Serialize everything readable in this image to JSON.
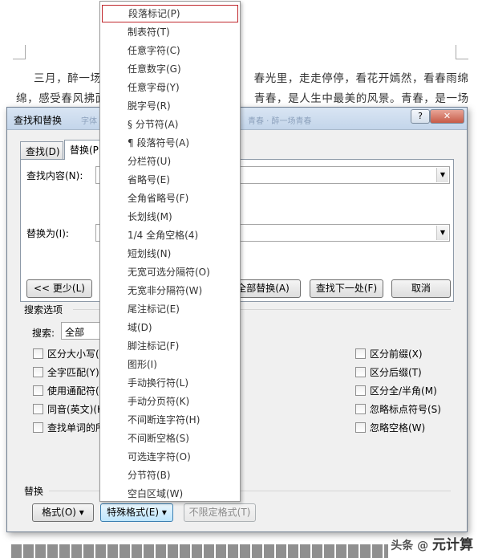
{
  "document": {
    "line1": "三月，醉一场",
    "line1_tail": "春光里，走走停停，看花开嫣然，看春雨绵",
    "line2": "绵，感受春风拂面",
    "line2_tail": "青春，是人生中最美的风景。青春，是一场",
    "watermark_small": "头条 @",
    "watermark_big": "元计算"
  },
  "dialog": {
    "title": "查找和替换",
    "title_ghost_1": "字体 · 三月 醉一场",
    "title_ghost_2": "青春 · 醉一场青春",
    "help_label": "?",
    "close_label": "✕",
    "tabs": {
      "find": "查找(D)",
      "replace": "替换(P)"
    },
    "find_label": "查找内容(N):",
    "replace_label": "替换为(I):",
    "less_button": "<< 更少(L)",
    "replace_all_button": "全部替换(A)",
    "find_next_button": "查找下一处(F)",
    "cancel_button": "取消",
    "search_options_label": "搜索选项",
    "search_label": "搜索:",
    "search_value": "全部",
    "options_left": [
      "区分大小写(",
      "全字匹配(Y)",
      "使用通配符(",
      "同音(英文)(K",
      "查找单词的所"
    ],
    "options_right": [
      "区分前缀(X)",
      "区分后缀(T)",
      "区分全/半角(M)",
      "忽略标点符号(S)",
      "忽略空格(W)"
    ],
    "replace_section_label": "替换",
    "format_button": "格式(O) ▾",
    "special_button": "特殊格式(E) ▾",
    "no_format_button": "不限定格式(T)"
  },
  "menu": {
    "items": [
      "段落标记(P)",
      "制表符(T)",
      "任意字符(C)",
      "任意数字(G)",
      "任意字母(Y)",
      "脱字号(R)",
      "§ 分节符(A)",
      "¶ 段落符号(A)",
      "分栏符(U)",
      "省略号(E)",
      "全角省略号(F)",
      "长划线(M)",
      "1/4 全角空格(4)",
      "短划线(N)",
      "无宽可选分隔符(O)",
      "无宽非分隔符(W)",
      "尾注标记(E)",
      "域(D)",
      "脚注标记(F)",
      "图形(I)",
      "手动换行符(L)",
      "手动分页符(K)",
      "不间断连字符(H)",
      "不间断空格(S)",
      "可选连字符(O)",
      "分节符(B)",
      "空白区域(W)"
    ]
  }
}
